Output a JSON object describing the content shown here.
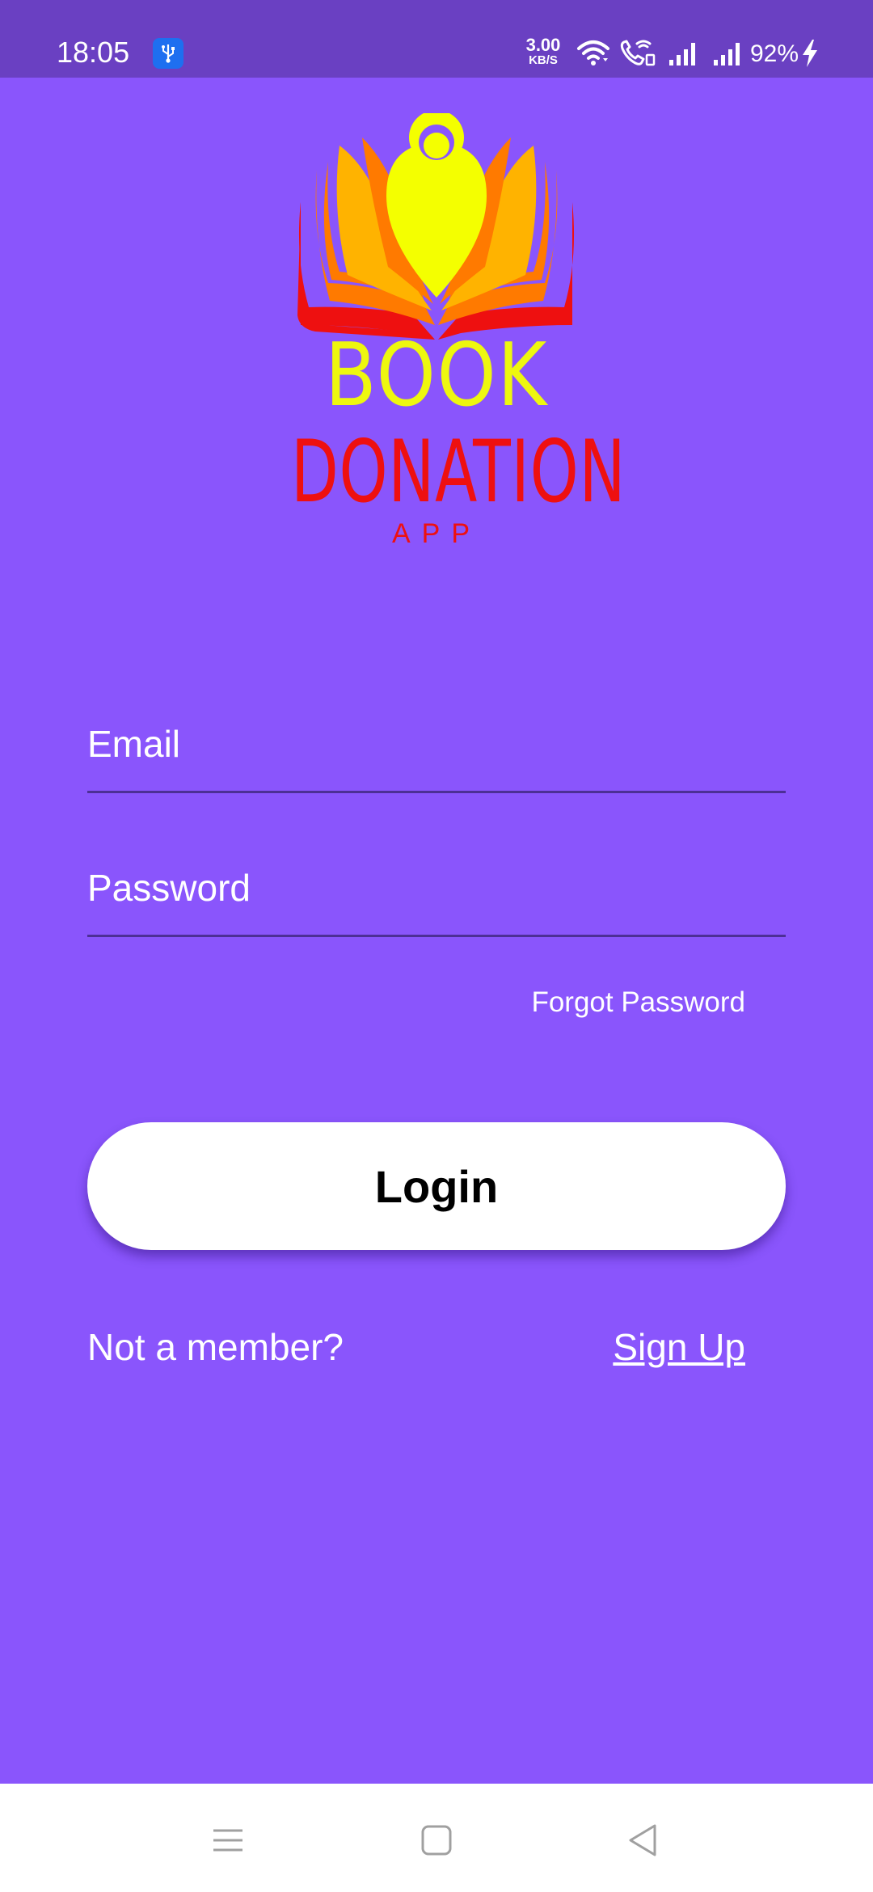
{
  "status_bar": {
    "time": "18:05",
    "net_speed_value": "3.00",
    "net_speed_unit": "KB/S",
    "battery": "92%",
    "icons": [
      "usb-debug-icon",
      "wifi-icon",
      "wifi-calling-icon",
      "signal-icon",
      "signal-icon",
      "charging-bolt-icon"
    ]
  },
  "logo": {
    "line1": "BOOK",
    "line2": "DONATION",
    "line3": "APP",
    "colors": {
      "book_text": "#eef70f",
      "donation_text": "#ee1010",
      "outer_leaves": "#ee1010",
      "middle_leaves": "#ff7a00",
      "inner_leaves": "#ffb300",
      "center_drop": "#f4ff00"
    }
  },
  "form": {
    "email": {
      "placeholder": "Email",
      "value": ""
    },
    "password": {
      "placeholder": "Password",
      "value": ""
    },
    "forgot_password": "Forgot Password",
    "login_label": "Login",
    "not_member": "Not a member?",
    "signup_label": "Sign Up"
  },
  "theme": {
    "background": "#8a55fc",
    "status_bar": "#6a40c2",
    "button_bg": "#ffffff",
    "button_text": "#000000"
  },
  "nav_bar": {
    "buttons": [
      "menu-icon",
      "home-icon",
      "back-icon"
    ]
  }
}
